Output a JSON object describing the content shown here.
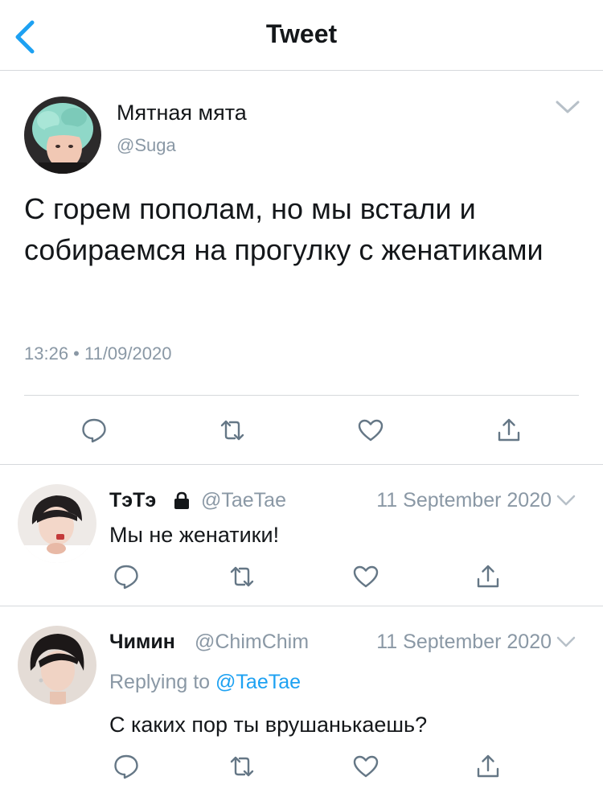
{
  "header": {
    "title": "Tweet"
  },
  "tweet": {
    "name": "Мятная мята",
    "handle": "@Suga",
    "text": "С горем пополам, но мы встали и собираемся на прогулку с женатиками",
    "timestamp": "13:26 • 11/09/2020"
  },
  "replies": [
    {
      "name": "ТэТэ",
      "handle": "@TaeTae",
      "date": "11 September 2020",
      "text": "Мы не женатики!"
    },
    {
      "name": "Чимин",
      "handle": "@ChimChim",
      "date": "11 September 2020",
      "replying_prefix": "Replying to ",
      "replying_to": "@TaeTae",
      "text": "С каких пор ты врушанькаешь?"
    }
  ],
  "colors": {
    "accent": "#1da1f2",
    "muted": "#8a98a5",
    "icon": "#657786",
    "divider": "#d6d9dc"
  },
  "icons": [
    "back-icon",
    "chevron-down-icon",
    "reply-icon",
    "retweet-icon",
    "like-icon",
    "share-icon",
    "lock-icon"
  ]
}
